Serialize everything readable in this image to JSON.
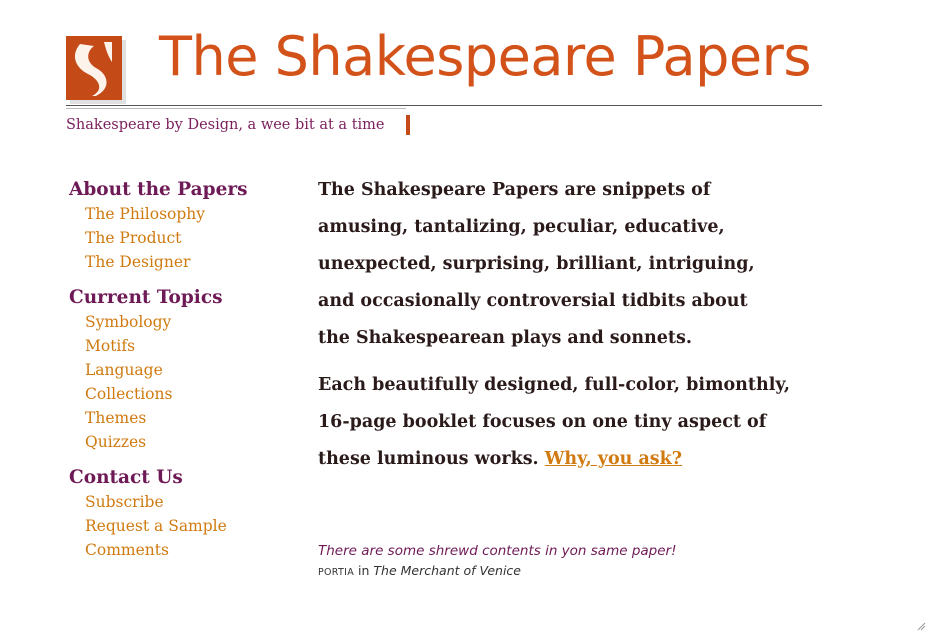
{
  "header": {
    "site_title": "The Shakespeare Papers",
    "tagline": "Shakespeare by Design, a wee bit at a time",
    "logo_icon": "stylized-s-icon",
    "colors": {
      "title": "#d2521a",
      "tagline": "#7b1f5c",
      "logo": "#c44a17"
    }
  },
  "sidebar": {
    "sections": [
      {
        "heading": "About the Papers",
        "items": [
          "The Philosophy",
          "The Product",
          "The Designer"
        ]
      },
      {
        "heading": "Current Topics",
        "items": [
          "Symbology",
          "Motifs",
          "Language",
          "Collections",
          "Themes",
          "Quizzes"
        ]
      },
      {
        "heading": "Contact Us",
        "items": [
          "Subscribe",
          "Request a Sample",
          "Comments"
        ]
      }
    ],
    "colors": {
      "heading": "#6e1a56",
      "link": "#d07a10"
    }
  },
  "main": {
    "paragraph1": [
      "The Shakespeare Papers are snippets of",
      "amusing, tantalizing, peculiar, educative,",
      "unexpected, surprising, brilliant, intriguing,",
      "and occasionally controversial tidbits about",
      "the Shakespearean plays and sonnets."
    ],
    "paragraph2": [
      "Each beautifully designed, full-color, bimonthly,",
      "16-page booklet focuses on one tiny aspect of",
      "these luminous works."
    ],
    "why_link": "Why, you ask?"
  },
  "quote": {
    "text": "There are some shrewd contents in yon same paper!",
    "speaker": "PORTIA",
    "connector": "in",
    "play": "The Merchant of Venice"
  }
}
